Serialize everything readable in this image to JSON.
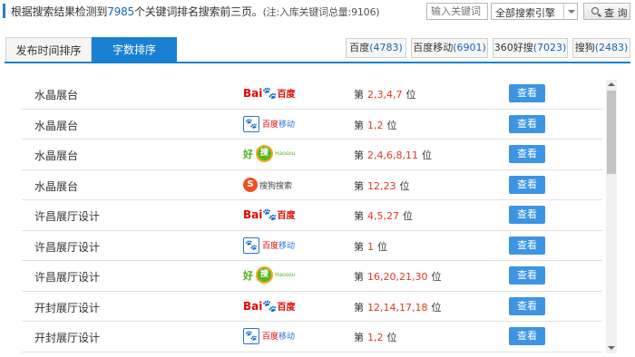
{
  "header": {
    "summary_prefix": "根据搜索结果检测到",
    "keyword_count": "7985",
    "summary_suffix": "个关键词排名搜索前三页。",
    "note": "(注:入库关键词总量:9106)",
    "search_placeholder": "输入关键词",
    "engine_select_value": "全部搜索引擎",
    "query_label": "查 询"
  },
  "sort_tabs": [
    {
      "label": "发布时间排序",
      "active": false
    },
    {
      "label": "字数排序",
      "active": true
    }
  ],
  "engine_tabs": [
    {
      "name": "百度",
      "count": "(4783)"
    },
    {
      "name": "百度移动",
      "count": "(6901)"
    },
    {
      "name": "360好搜",
      "count": "(7023)"
    },
    {
      "name": "搜狗",
      "count": "(2483)"
    }
  ],
  "rank_prefix": "第",
  "rank_suffix": "位",
  "view_label": "查看",
  "rows": [
    {
      "keyword": "水晶展台",
      "engine": "baidu",
      "pages": "2,3,4,7"
    },
    {
      "keyword": "水晶展台",
      "engine": "baidu-mobile",
      "pages": "1,2"
    },
    {
      "keyword": "水晶展台",
      "engine": "haosou",
      "pages": "2,4,6,8,11"
    },
    {
      "keyword": "水晶展台",
      "engine": "sogou",
      "pages": "12,23"
    },
    {
      "keyword": "许昌展厅设计",
      "engine": "baidu",
      "pages": "4,5,27"
    },
    {
      "keyword": "许昌展厅设计",
      "engine": "baidu-mobile",
      "pages": "1"
    },
    {
      "keyword": "许昌展厅设计",
      "engine": "haosou",
      "pages": "16,20,21,30"
    },
    {
      "keyword": "开封展厅设计",
      "engine": "baidu",
      "pages": "12,14,17,18"
    },
    {
      "keyword": "开封展厅设计",
      "engine": "baidu-mobile",
      "pages": "1,2"
    }
  ],
  "logos": {
    "baidu": {
      "bai": "Bai",
      "paw": "🐾",
      "du": "百度"
    },
    "baidu-mobile": {
      "icon": "🐾",
      "red": "百度",
      "blue": "移动"
    },
    "haosou": {
      "hao": "好",
      "sou": "搜",
      "en": "Haosou"
    },
    "sogou": {
      "s": "S",
      "text": "搜狗搜索"
    }
  },
  "colors": {
    "accent": "#1a80d2",
    "button": "#3b95e3",
    "rank_numbers": "#e5391c",
    "count_numbers": "#1a66b3"
  },
  "icons": [
    "search-icon",
    "dropdown-arrow-icon",
    "scroll-up-icon",
    "scroll-down-icon"
  ]
}
